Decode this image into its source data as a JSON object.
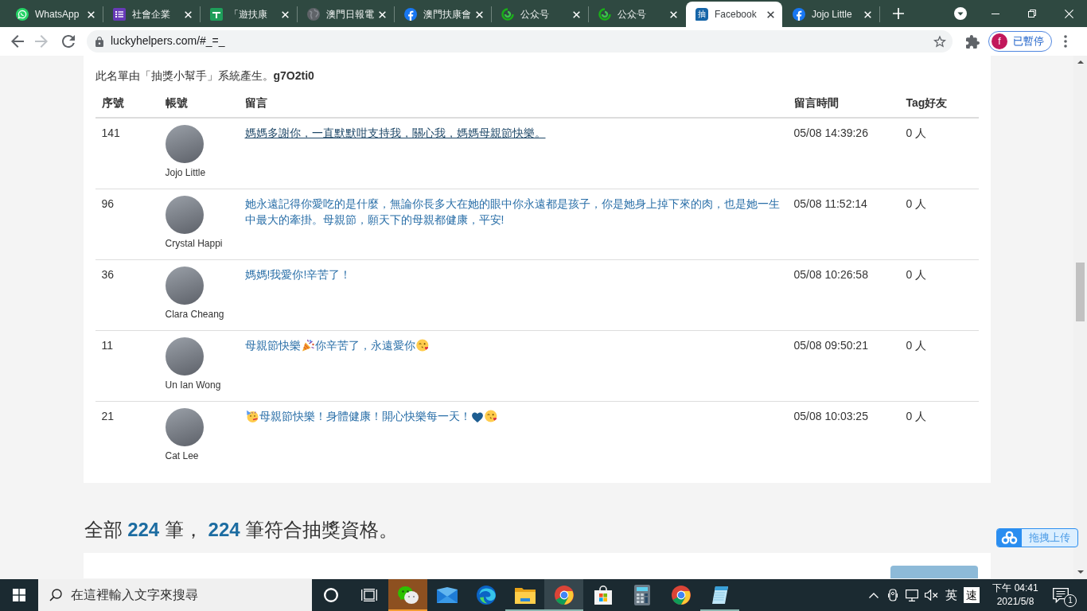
{
  "browser": {
    "tabs": [
      {
        "title": "WhatsApp",
        "kind": "chat",
        "selected": false
      },
      {
        "title": "社會企業",
        "kind": "list",
        "selected": false
      },
      {
        "title": "「遊扶康",
        "kind": "sheet",
        "selected": false
      },
      {
        "title": "澳門日報電",
        "kind": "globe",
        "selected": false
      },
      {
        "title": "澳門扶康會",
        "kind": "circlef",
        "selected": false
      },
      {
        "title": "公众号",
        "kind": "swirl",
        "selected": false
      },
      {
        "title": "公众号",
        "kind": "swirl",
        "selected": false
      },
      {
        "title": "Facebook",
        "kind": "badge",
        "badge": "抽",
        "selected": true
      },
      {
        "title": "Jojo Little",
        "kind": "circlef",
        "selected": false
      }
    ],
    "address": "luckyhelpers.com/#_=_",
    "profile": {
      "initial": "f",
      "label": "已暫停"
    }
  },
  "page": {
    "note": "此名單由「抽獎小幫手」系統產生。**g7O2ti0**",
    "table": {
      "columns": [
        "序號",
        "帳號",
        "留言",
        "留言時間",
        "Tag好友"
      ],
      "rows": [
        {
          "number": "141",
          "account": "Jojo Little",
          "message": [
            {
              "kind": "text",
              "text": "媽媽多謝你，一直默默咁支持我，關心我，媽媽母親節快樂。"
            }
          ],
          "hovered": true,
          "time": "05/08 14:39:26",
          "tags": "0 人"
        },
        {
          "number": "96",
          "account": "Crystal Happi",
          "message": [
            {
              "kind": "text",
              "text": "她永遠記得你愛吃的是什麼，無論你長多大在她的眼中你永遠都是孩子，你是她身上掉下來的肉，也是她一生中最大的牽掛。母親節，願天下的母親都健康，平安!"
            }
          ],
          "hovered": false,
          "time": "05/08 11:52:14",
          "tags": "0 人"
        },
        {
          "number": "36",
          "account": "Clara Cheang",
          "message": [
            {
              "kind": "text",
              "text": "媽媽!我愛你!辛苦了！"
            }
          ],
          "hovered": false,
          "time": "05/08 10:26:58",
          "tags": "0 人"
        },
        {
          "number": "11",
          "account": "Un Ian Wong",
          "message": [
            {
              "kind": "text",
              "text": "母親節快樂"
            },
            {
              "kind": "popper"
            },
            {
              "kind": "text",
              "text": "你辛苦了，永遠愛你"
            },
            {
              "kind": "kiss"
            }
          ],
          "hovered": false,
          "time": "05/08 09:50:21",
          "tags": "0 人"
        },
        {
          "number": "21",
          "account": "Cat Lee",
          "message": [
            {
              "kind": "partyface"
            },
            {
              "kind": "text",
              "text": "母親節快樂！身體健康！開心快樂每一天！"
            },
            {
              "kind": "heart"
            },
            {
              "kind": "kiss"
            }
          ],
          "hovered": false,
          "time": "05/08 10:03:25",
          "tags": "0 人"
        }
      ]
    },
    "summary": "全部 **224** 筆， **224** 筆符合抽獎資格。"
  },
  "upload_widget": {
    "label": "拖拽上传"
  },
  "taskbar": {
    "search": {
      "placeholder": "在這裡輸入文字來搜尋"
    },
    "apps": [
      {
        "kind": "chat",
        "open": true,
        "selected": false,
        "flashing": true
      },
      {
        "kind": "mail",
        "open": false,
        "selected": false,
        "flashing": false
      },
      {
        "kind": "swirl",
        "open": false,
        "selected": false,
        "flashing": false
      },
      {
        "kind": "folder",
        "open": true,
        "selected": false,
        "flashing": false
      },
      {
        "kind": "browser",
        "open": true,
        "selected": true,
        "flashing": false
      },
      {
        "kind": "store",
        "open": false,
        "selected": false,
        "flashing": false
      },
      {
        "kind": "calculator",
        "open": false,
        "selected": false,
        "flashing": false
      },
      {
        "kind": "browser",
        "open": false,
        "selected": false,
        "flashing": false
      },
      {
        "kind": "notepad",
        "open": true,
        "selected": false,
        "flashing": false
      }
    ],
    "tray": {
      "language": "英",
      "ime": "速",
      "time": "下午 04:41",
      "date": "2021/5/8",
      "notifications": "1"
    }
  }
}
